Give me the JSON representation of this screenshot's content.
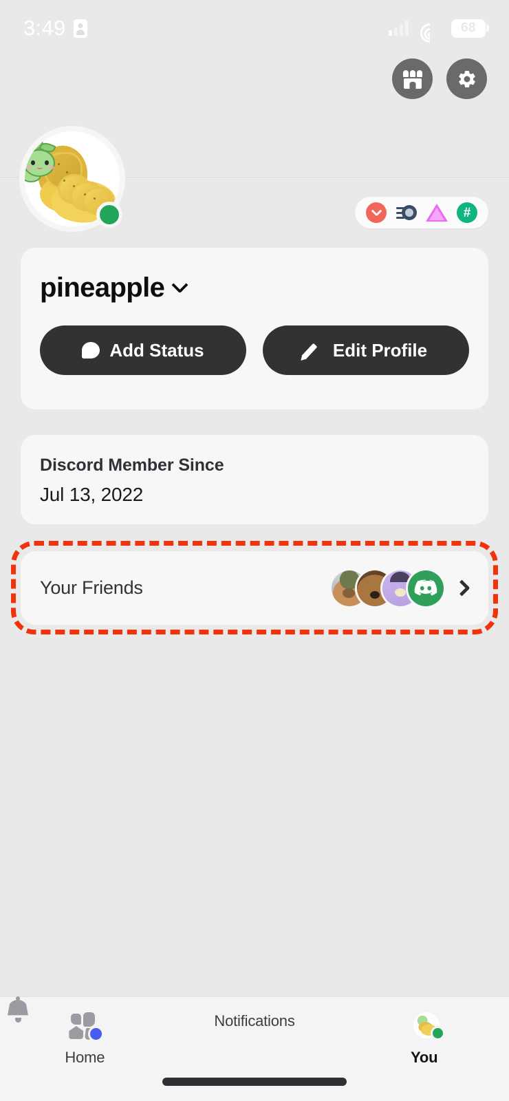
{
  "status_bar": {
    "time": "3:49",
    "time_icon": "contact-card-icon",
    "signal_icon": "cellular-signal-icon",
    "wifi_icon": "wifi-icon",
    "battery_level": "68"
  },
  "header": {
    "shop_button_icon": "shop-icon",
    "settings_button_icon": "gear-icon"
  },
  "profile": {
    "avatar_icon": "pineapple-avatar",
    "avatar_decoration": "green-creature-decoration",
    "presence": "online",
    "presence_color": "#23a559",
    "username": "pineapple",
    "username_chevron_icon": "chevron-down-icon",
    "badges": [
      {
        "name": "nitro-badge",
        "icon": "chevron-down-circle-icon",
        "color": "#f0675a"
      },
      {
        "name": "active-developer-badge",
        "icon": "comet-icon",
        "color": "#3b4a66"
      },
      {
        "name": "quest-badge",
        "icon": "triangle-icon",
        "color": "#e96df0"
      },
      {
        "name": "hash-badge",
        "icon": "hash-circle-icon",
        "color": "#10b481"
      }
    ],
    "actions": [
      {
        "name": "add-status-button",
        "label": "Add Status",
        "icon": "speech-bubble-icon"
      },
      {
        "name": "edit-profile-button",
        "label": "Edit Profile",
        "icon": "pencil-icon"
      }
    ]
  },
  "member_since": {
    "label": "Discord Member Since",
    "date": "Jul 13, 2022"
  },
  "friends": {
    "label": "Your Friends",
    "chevron_icon": "chevron-right-icon",
    "avatars": [
      {
        "name": "friend-avatar-1",
        "icon": "tan-dog-avatar"
      },
      {
        "name": "friend-avatar-2",
        "icon": "brown-dog-avatar"
      },
      {
        "name": "friend-avatar-3",
        "icon": "purple-character-avatar"
      },
      {
        "name": "friend-avatar-4",
        "icon": "discord-clyde-avatar"
      }
    ],
    "highlight_color": "#f1330d"
  },
  "bottom_nav": {
    "items": [
      {
        "name": "nav-home",
        "label": "Home",
        "icon": "servers-home-icon",
        "badge": true,
        "badge_color": "#4a5bf0",
        "active": false
      },
      {
        "name": "nav-notifications",
        "label": "Notifications",
        "icon": "bell-icon",
        "badge": false,
        "active": false
      },
      {
        "name": "nav-you",
        "label": "You",
        "icon": "user-avatar-icon",
        "badge": false,
        "active": true
      }
    ]
  }
}
